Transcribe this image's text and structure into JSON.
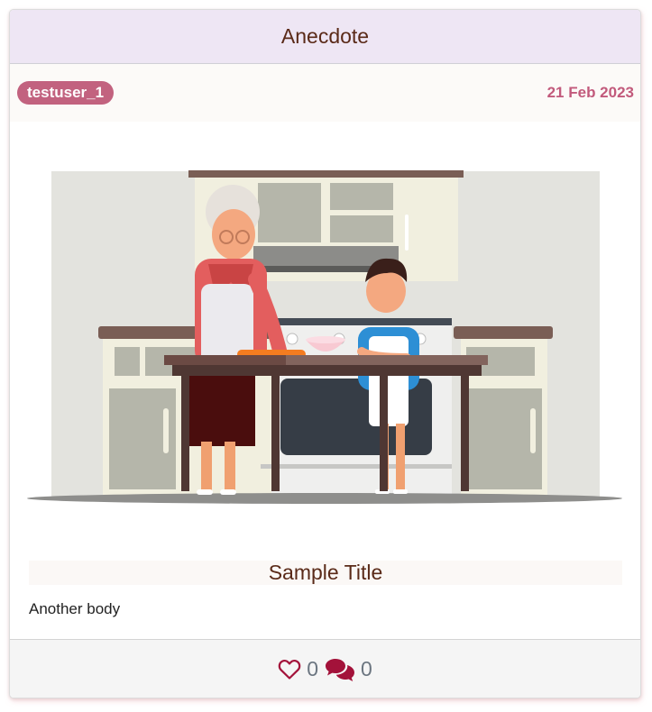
{
  "header": {
    "title": "Anecdote"
  },
  "meta": {
    "username": "testuser_1",
    "date": "21 Feb 2023"
  },
  "post": {
    "image_alt": "Grandmother and boy baking in a kitchen",
    "title": "Sample Title",
    "body": "Another body"
  },
  "footer": {
    "likes": "0",
    "comments": "0",
    "like_icon": "heart-outline-icon",
    "comment_icon": "comments-icon"
  },
  "colors": {
    "header_bg": "#eee6f4",
    "badge": "#c2627f",
    "date": "#c25a7c",
    "icons": "#a3123a"
  }
}
